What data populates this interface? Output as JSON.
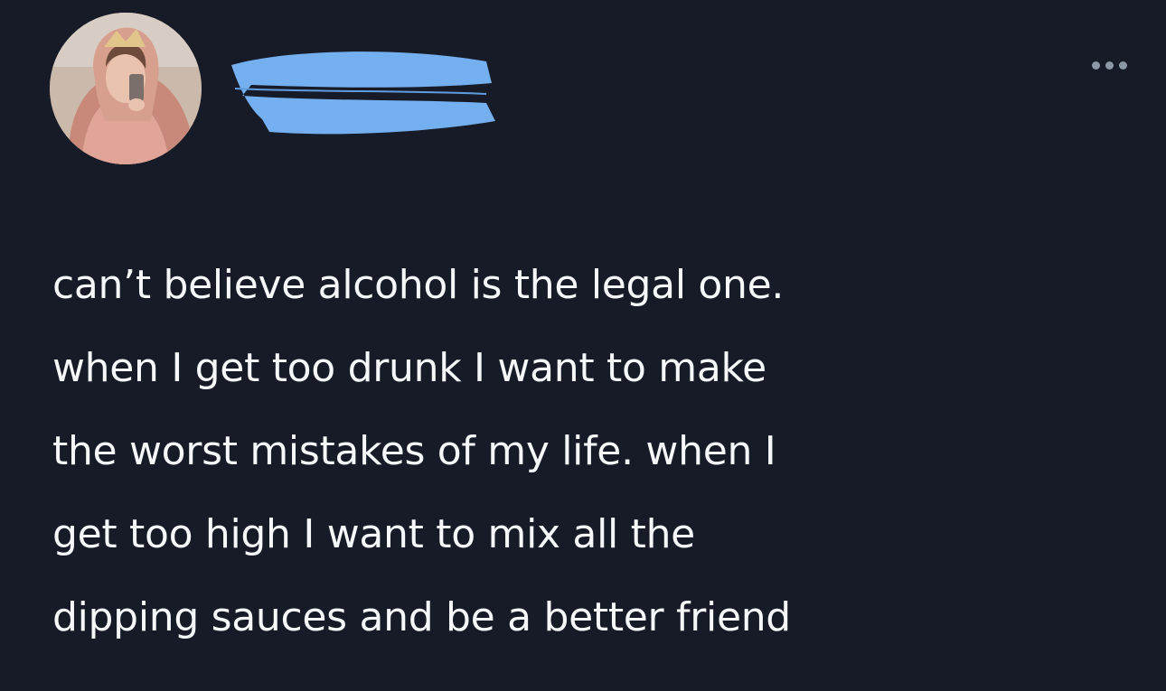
{
  "tweet": {
    "author_name": "",
    "text_lines": [
      "can’t believe alcohol is the legal one.",
      "when I get too drunk I want to make",
      "the worst mistakes of my life. when I",
      "get too high I want to mix all the",
      "dipping sauces and be a better friend"
    ]
  },
  "icons": {
    "more": "more-dots-icon",
    "avatar": "avatar"
  },
  "colors": {
    "background": "#161b27",
    "text": "#f5f7f8",
    "redaction": "#74b0f0",
    "muted": "#8b98a5"
  }
}
